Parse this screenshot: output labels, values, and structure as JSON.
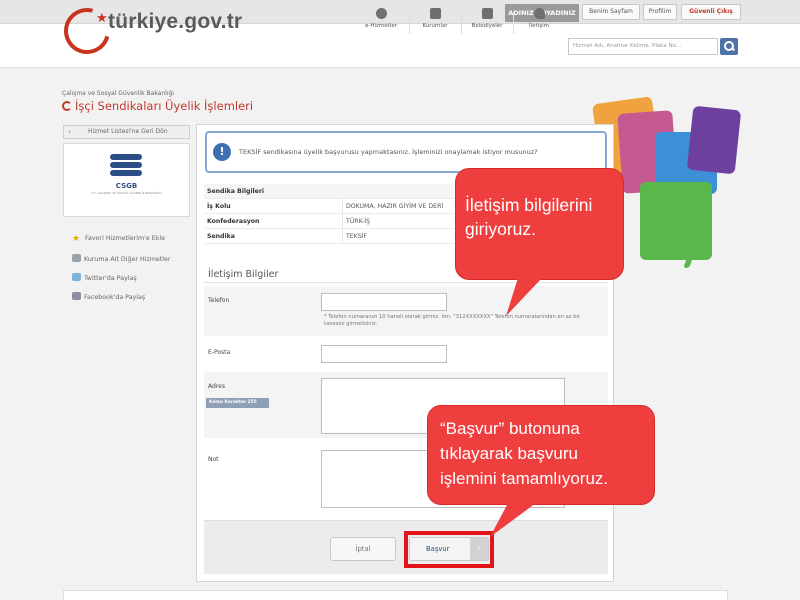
{
  "topbar": {
    "user_name": "ADINIZ-SOYADINIZ",
    "my_page": "Benim Sayfam",
    "profile": "Profilim",
    "logout": "Güvenli Çıkış"
  },
  "header": {
    "logo_text": "türkiye.gov.tr",
    "nav": [
      {
        "label": "e-Hizmetler"
      },
      {
        "label": "Kurumlar"
      },
      {
        "label": "Belediyeler"
      },
      {
        "label": "İletişim"
      }
    ],
    "search_placeholder": "Hizmet Adı, Anahtar Kelime, Plaka No..."
  },
  "page": {
    "ministry": "Çalışma ve Sosyal Güvenlik Bakanlığı",
    "title": "İşçi Sendikaları Üyelik İşlemleri"
  },
  "sidebar": {
    "back_label": "Hizmet Listesi'ne Geri Dön",
    "org_logo_text": "CSGB",
    "org_logo_sub": "T.C. ÇALIŞMA VE SOSYAL GÜVENLİK BAKANLIĞI",
    "links": [
      {
        "label": "Favori Hizmetlerim'e Ekle",
        "icon": "star-icon"
      },
      {
        "label": "Kuruma Ait Diğer Hizmetler",
        "icon": "arrow-icon"
      },
      {
        "label": "Twitter'da Paylaş",
        "icon": "twitter-icon"
      },
      {
        "label": "Facebook'da Paylaş",
        "icon": "facebook-icon"
      }
    ]
  },
  "confirm": {
    "message": "TEKSİF sendikasına üyelik başvurusu yapmaktasınız. İşleminizi onaylamak istiyor musunuz?"
  },
  "union_info": {
    "heading": "Sendika Bilgileri",
    "rows": [
      {
        "label": "İş Kolu",
        "value": "DOKUMA, HAZIR GİYİM VE DERİ"
      },
      {
        "label": "Konfederasyon",
        "value": "TÜRK-İŞ"
      },
      {
        "label": "Sendika",
        "value": "TEKSİF"
      }
    ]
  },
  "contact": {
    "heading": "İletişim Bilgiler",
    "phone_label": "Telefon",
    "phone_hint": "* Telefon numaranızı 10 haneli olarak giriniz. örn. \"312XXXXXXX\" Telefon numaralarından en az bir tanesini girmelisiniz.",
    "email_label": "E-Posta",
    "address_label": "Adres",
    "remaining_chars": "Kalan Karakter 255",
    "note_label": "Not"
  },
  "actions": {
    "cancel": "İptal",
    "submit": "Başvur",
    "submit_arrow": "›"
  },
  "callouts": {
    "contact_info": [
      "İletişim bilgilerini",
      "giriyoruz."
    ],
    "submit_info": [
      "“Başvur” butonuna",
      "tıklayarak başvuru",
      "işlemini tamamlıyoruz."
    ]
  },
  "colors": {
    "brand_red": "#c8341e",
    "callout_red": "#ef3e3e",
    "highlight_red": "#e2141a",
    "info_blue": "#3f6fb0"
  }
}
